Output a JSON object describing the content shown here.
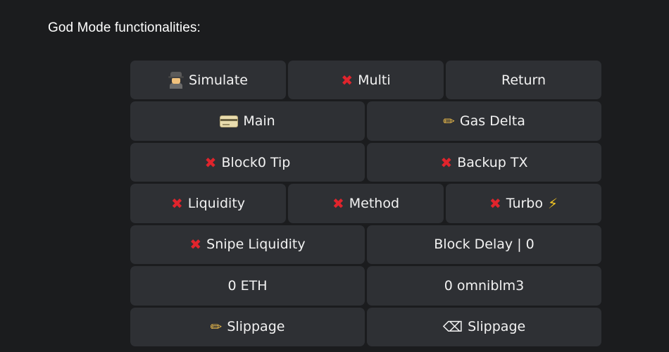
{
  "heading": "God Mode functionalities:",
  "keyboard": {
    "rows": [
      [
        {
          "label": "Simulate",
          "icon": "detective-icon"
        },
        {
          "label": "Multi",
          "icon": "cross-mark-icon"
        },
        {
          "label": "Return",
          "icon": ""
        }
      ],
      [
        {
          "label": "Main",
          "icon": "credit-card-icon"
        },
        {
          "label": "Gas Delta",
          "icon": "pencil-icon"
        }
      ],
      [
        {
          "label": "Block0 Tip",
          "icon": "cross-mark-icon"
        },
        {
          "label": "Backup TX",
          "icon": "cross-mark-icon"
        }
      ],
      [
        {
          "label": "Liquidity",
          "icon": "cross-mark-icon"
        },
        {
          "label": "Method",
          "icon": "cross-mark-icon"
        },
        {
          "label": "Turbo",
          "icon": "cross-mark-icon",
          "trailing_icon": "lightning-icon"
        }
      ],
      [
        {
          "label": "Snipe Liquidity",
          "icon": "cross-mark-icon"
        },
        {
          "label": "Block Delay | 0",
          "icon": ""
        }
      ],
      [
        {
          "label": "0 ETH",
          "icon": ""
        },
        {
          "label": "0 omniblm3",
          "icon": ""
        }
      ],
      [
        {
          "label": "Slippage",
          "icon": "pencil-icon"
        },
        {
          "label": "Slippage",
          "icon": "backspace-icon"
        }
      ]
    ]
  },
  "colors": {
    "background": "#1b1c1e",
    "button": "#2e3034",
    "text": "#f2f2f2",
    "cross": "#e0242c"
  }
}
